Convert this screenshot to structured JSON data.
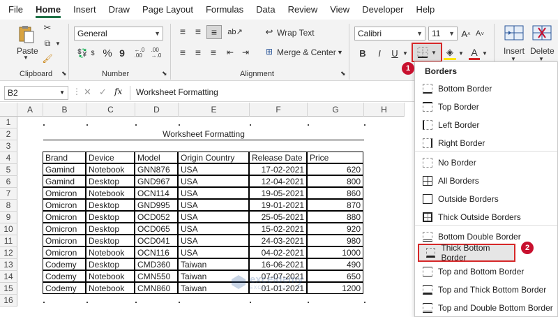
{
  "menu": [
    "File",
    "Home",
    "Insert",
    "Draw",
    "Page Layout",
    "Formulas",
    "Data",
    "Review",
    "View",
    "Developer",
    "Help"
  ],
  "ribbon": {
    "paste": "Paste",
    "clipboard": "Clipboard",
    "number_format": "General",
    "number": "Number",
    "wrap_text": "Wrap Text",
    "merge_center": "Merge & Center",
    "alignment": "Alignment",
    "font_name": "Calibri",
    "font_size": "11",
    "bold": "B",
    "italic": "I",
    "underline": "U",
    "insert": "Insert",
    "delete": "Delete",
    "currency": "$",
    "percent": "%",
    "comma": "9",
    "grow": "A",
    "shrink": "A",
    "font_color": "A"
  },
  "formula_bar": {
    "name_box": "B2",
    "fx": "fx",
    "content": "Worksheet Formatting"
  },
  "columns": [
    "A",
    "B",
    "C",
    "D",
    "E",
    "F",
    "G",
    "H"
  ],
  "rows": [
    "1",
    "2",
    "3",
    "4",
    "5",
    "6",
    "7",
    "8",
    "9",
    "10",
    "11",
    "12",
    "13",
    "14",
    "15",
    "16"
  ],
  "sheet": {
    "title": "Worksheet Formatting",
    "headers": [
      "Brand",
      "Device",
      "Model",
      "Origin Country",
      "Release Date",
      "Price"
    ],
    "data": [
      [
        "Gamind",
        "Notebook",
        "GNN876",
        "USA",
        "17-02-2021",
        "620"
      ],
      [
        "Gamind",
        "Desktop",
        "GND967",
        "USA",
        "12-04-2021",
        "800"
      ],
      [
        "Omicron",
        "Notebook",
        "OCN114",
        "USA",
        "19-05-2021",
        "860"
      ],
      [
        "Omicron",
        "Desktop",
        "GND995",
        "USA",
        "19-01-2021",
        "870"
      ],
      [
        "Omicron",
        "Desktop",
        "OCD052",
        "USA",
        "25-05-2021",
        "880"
      ],
      [
        "Omicron",
        "Desktop",
        "OCD065",
        "USA",
        "15-02-2021",
        "920"
      ],
      [
        "Omicron",
        "Desktop",
        "OCD041",
        "USA",
        "24-03-2021",
        "980"
      ],
      [
        "Omicron",
        "Notebook",
        "OCN116",
        "USA",
        "04-02-2021",
        "1000"
      ],
      [
        "Codemy",
        "Desktop",
        "CMD360",
        "Taiwan",
        "16-06-2021",
        "490"
      ],
      [
        "Codemy",
        "Notebook",
        "CMN550",
        "Taiwan",
        "07-07-2021",
        "650"
      ],
      [
        "Codemy",
        "Notebook",
        "CMN860",
        "Taiwan",
        "01-01-2021",
        "1200"
      ]
    ]
  },
  "borders_menu": {
    "title": "Borders",
    "items": [
      "Bottom Border",
      "Top Border",
      "Left Border",
      "Right Border",
      "No Border",
      "All Borders",
      "Outside Borders",
      "Thick Outside Borders",
      "Bottom Double Border",
      "Thick Bottom Border",
      "Top and Bottom Border",
      "Top and Thick Bottom Border",
      "Top and Double Bottom Border"
    ]
  },
  "badges": [
    "1",
    "2"
  ],
  "watermark": "exceldemy",
  "watermark_sub": "EXCEL · DATA · BI",
  "colors": {
    "accent": "#1e7145",
    "badge": "#c8102e",
    "highlight": "#d62728"
  }
}
